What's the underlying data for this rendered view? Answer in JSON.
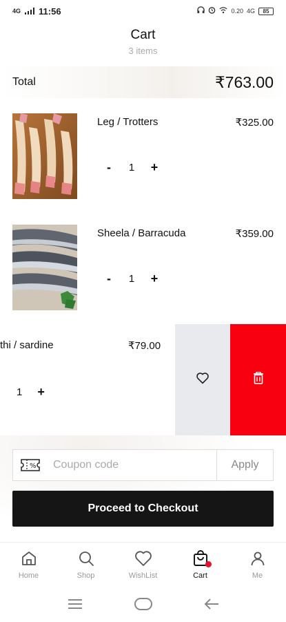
{
  "status_bar": {
    "signal": "4G",
    "time": "11:56",
    "net_speed": "0.20",
    "net_type": "4G",
    "battery": "85"
  },
  "header": {
    "title": "Cart",
    "subtitle": "3 items"
  },
  "total": {
    "label": "Total",
    "value": "₹763.00"
  },
  "items": [
    {
      "name": "Leg / Trotters",
      "price": "₹325.00",
      "qty": "1",
      "minus": "-",
      "plus": "+"
    },
    {
      "name": "Sheela / Barracuda",
      "price": "₹359.00",
      "qty": "1",
      "minus": "-",
      "plus": "+"
    },
    {
      "name": "thi / sardine",
      "price": "₹79.00",
      "qty": "1",
      "plus": "+"
    }
  ],
  "swipe_actions": {
    "wishlist_icon": "heart-icon",
    "delete_icon": "trash-icon",
    "delete_color": "#f8000f",
    "wishlist_bg": "#e8eaed"
  },
  "coupon": {
    "placeholder": "Coupon code",
    "apply_label": "Apply"
  },
  "checkout": {
    "label": "Proceed to Checkout"
  },
  "bottom_nav": [
    {
      "label": "Home",
      "icon": "home-icon"
    },
    {
      "label": "Shop",
      "icon": "search-icon"
    },
    {
      "label": "WishList",
      "icon": "heart-icon"
    },
    {
      "label": "Cart",
      "icon": "cart-icon",
      "active": true
    },
    {
      "label": "Me",
      "icon": "user-icon"
    }
  ]
}
